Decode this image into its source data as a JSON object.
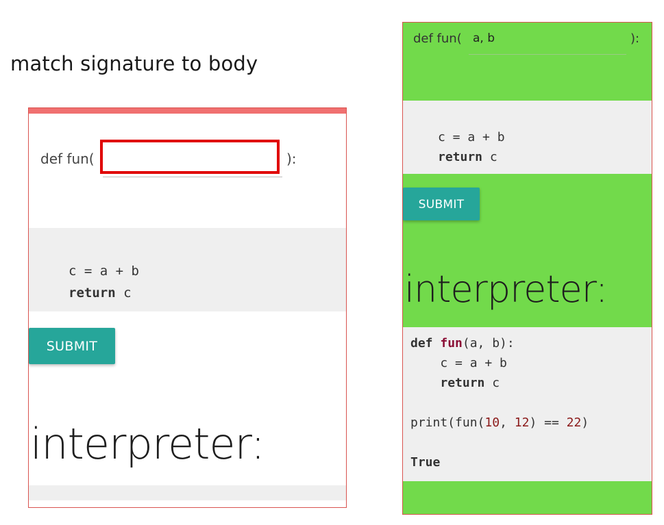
{
  "page": {
    "title": "match signature to body"
  },
  "left_panel": {
    "signature_prefix": "def fun(",
    "signature_suffix": "):",
    "params_value": "",
    "body_line1": "c = a + b",
    "body_kw_return": "return",
    "body_return_var": "c",
    "submit_label": "SUBMIT",
    "interpreter_label": "interpreter:"
  },
  "right_panel": {
    "signature_prefix": "def fun(",
    "signature_suffix": "):",
    "params_value": "a, b",
    "body_line1": "c = a + b",
    "body_kw_return": "return",
    "body_return_var": "c",
    "submit_label": "SUBMIT",
    "interpreter_label": "interpreter:",
    "output": {
      "kw_def": "def",
      "fn_name": "fun",
      "fn_params": "(a, b):",
      "line_c": "c = a + b",
      "kw_return": "return",
      "return_var": "c",
      "print_prefix": "print(fun(",
      "arg1": "10",
      "arg_sep": ", ",
      "arg2": "12",
      "print_mid": ") == ",
      "expected": "22",
      "print_suffix": ")",
      "result": "True"
    }
  },
  "colors": {
    "success_bg": "#72da4b",
    "error_border": "#d9534f",
    "top_bar_error": "#f07070",
    "focus_border": "#e00000",
    "button_teal": "#26a69a",
    "code_bg": "#efefef"
  }
}
